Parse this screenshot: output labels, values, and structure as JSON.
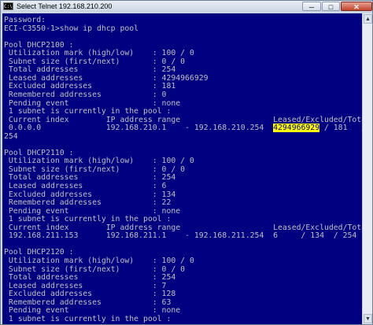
{
  "window": {
    "icon_text": "C:\\",
    "title": "Select Telnet 192.168.210.200",
    "minimize_label": "─",
    "maximize_label": "□",
    "close_label": "✕"
  },
  "console": {
    "lines": [
      "Password:",
      "ECI-C3550-1>show ip dhcp pool",
      "",
      "Pool DHCP2100 :",
      " Utilization mark (high/low)    : 100 / 0",
      " Subnet size (first/next)       : 0 / 0",
      " Total addresses                : 254",
      " Leased addresses               : 4294966929",
      " Excluded addresses             : 181",
      " Remembered addresses           : 0",
      " Pending event                  : none",
      " 1 subnet is currently in the pool :",
      " Current index        IP address range                    Leased/Excluded/Total",
      " 0.0.0.0              192.168.210.1    - 192.168.210.254",
      "254",
      "",
      "Pool DHCP2110 :",
      " Utilization mark (high/low)    : 100 / 0",
      " Subnet size (first/next)       : 0 / 0",
      " Total addresses                : 254",
      " Leased addresses               : 6",
      " Excluded addresses             : 134",
      " Remembered addresses           : 22",
      " Pending event                  : none",
      " 1 subnet is currently in the pool :",
      " Current index        IP address range                    Leased/Excluded/Total",
      " 192.168.211.153      192.168.211.1    - 192.168.211.254  6     / 134  / 254",
      "",
      "Pool DHCP2120 :",
      " Utilization mark (high/low)    : 100 / 0",
      " Subnet size (first/next)       : 0 / 0",
      " Total addresses                : 254",
      " Leased addresses               : 7",
      " Excluded addresses             : 128",
      " Remembered addresses           : 63",
      " Pending event                  : none",
      " 1 subnet is currently in the pool :"
    ],
    "highlight_line_index": 13,
    "highlight_text": "4294966929",
    "highlight_suffix": " / 181   /"
  },
  "scrollbar": {
    "up_icon": "▲",
    "down_icon": "▼"
  }
}
